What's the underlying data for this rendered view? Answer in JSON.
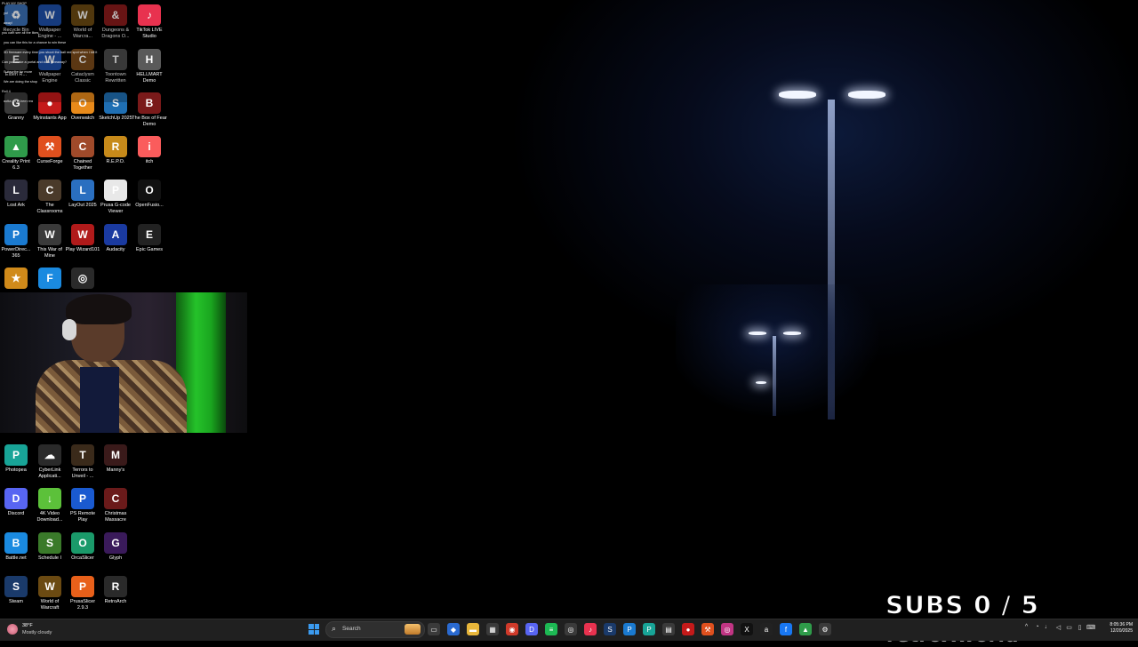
{
  "chat": [
    "PLAY MY SHOP",
    "yo!",
    "away!",
    "you cant see all the likes",
    "you can like this for a chance to win these",
    "3D firmware every time you shoot the ball red spot when I kill it",
    "Can you make a portal and do a giveaway?",
    "Subscribe for more",
    "We are doing the shop",
    "Roll 4",
    "gotta do kt-hem reg"
  ],
  "desktop_icons": [
    {
      "label": "Recycle Bin",
      "icon": "recycle-bin-icon",
      "color": "#3a6fb5",
      "glyph": "♻"
    },
    {
      "label": "Wallpaper Engine - ...",
      "icon": "wallpaper-engine-icon",
      "color": "#1e4fa8",
      "glyph": "W"
    },
    {
      "label": "World of Warcra...",
      "icon": "world-of-warcraft-icon",
      "color": "#6b4a12",
      "glyph": "W"
    },
    {
      "label": "Dungeons & Dragons O...",
      "icon": "dungeons-dragons-icon",
      "color": "#8a1b1b",
      "glyph": "&"
    },
    {
      "label": "TikTok LIVE Studio",
      "icon": "tiktok-live-icon",
      "color": "#e8324f",
      "glyph": "♪"
    },
    {
      "label": "Elden R...",
      "icon": "elden-ring-icon",
      "color": "#3b3b3b",
      "glyph": "E"
    },
    {
      "label": "Wallpaper Engine",
      "icon": "wallpaper-engine-icon",
      "color": "#1e4fa8",
      "glyph": "W"
    },
    {
      "label": "Cataclysm Classic",
      "icon": "cataclysm-icon",
      "color": "#7a4a1a",
      "glyph": "C"
    },
    {
      "label": "Toontown Rewritten",
      "icon": "toontown-icon",
      "color": "#4b4b4b",
      "glyph": "T"
    },
    {
      "label": "HELLMART Demo",
      "icon": "hellmart-icon",
      "color": "#5a5a5a",
      "glyph": "H"
    },
    {
      "label": "Granny",
      "icon": "granny-icon",
      "color": "#3a3a3a",
      "glyph": "G"
    },
    {
      "label": "Myinstants App",
      "icon": "myinstants-icon",
      "color": "#c41a1a",
      "glyph": "●"
    },
    {
      "label": "Overwatch",
      "icon": "overwatch-icon",
      "color": "#e88a1a",
      "glyph": "O"
    },
    {
      "label": "SketchUp 2025",
      "icon": "sketchup-icon",
      "color": "#1f6fb3",
      "glyph": "S"
    },
    {
      "label": "The Box of Fear Demo",
      "icon": "box-of-fear-icon",
      "color": "#7a1a1a",
      "glyph": "B"
    },
    {
      "label": "Creality Print 6.3",
      "icon": "creality-print-icon",
      "color": "#2f9b4a",
      "glyph": "▲"
    },
    {
      "label": "CurseForge",
      "icon": "curseforge-icon",
      "color": "#e0501e",
      "glyph": "⚒"
    },
    {
      "label": "Chained Together",
      "icon": "chained-together-icon",
      "color": "#a04a2a",
      "glyph": "C"
    },
    {
      "label": "R.E.P.O.",
      "icon": "repo-icon",
      "color": "#c78a1a",
      "glyph": "R"
    },
    {
      "label": "itch",
      "icon": "itch-icon",
      "color": "#fa5c5c",
      "glyph": "i"
    },
    {
      "label": "Lost Ark",
      "icon": "lost-ark-icon",
      "color": "#2a2a3a",
      "glyph": "L"
    },
    {
      "label": "The Classrooms",
      "icon": "classrooms-icon",
      "color": "#4a3a2a",
      "glyph": "C"
    },
    {
      "label": "LayOut 2025",
      "icon": "layout-icon",
      "color": "#2a6fc0",
      "glyph": "L"
    },
    {
      "label": "Prusa G-code Viewer",
      "icon": "prusa-viewer-icon",
      "color": "#e8e8e8",
      "glyph": "P"
    },
    {
      "label": "OpenFusio...",
      "icon": "openfusion-icon",
      "color": "#111111",
      "glyph": "O"
    },
    {
      "label": "PowerDirec... 365",
      "icon": "powerdirector-icon",
      "color": "#1a7ad0",
      "glyph": "P"
    },
    {
      "label": "This War of Mine",
      "icon": "this-war-of-mine-icon",
      "color": "#3a3a3a",
      "glyph": "W"
    },
    {
      "label": "Play Wizard101",
      "icon": "wizard101-icon",
      "color": "#b01a1a",
      "glyph": "W"
    },
    {
      "label": "Audacity",
      "icon": "audacity-icon",
      "color": "#1a3aa0",
      "glyph": "A"
    },
    {
      "label": "Epic Games",
      "icon": "epic-games-icon",
      "color": "#222222",
      "glyph": "E"
    },
    {
      "label": "",
      "icon": "game-icon",
      "color": "#d08a1a",
      "glyph": "★"
    },
    {
      "label": "",
      "icon": "facebook-gaming-icon",
      "color": "#1a8ae0",
      "glyph": "F"
    },
    {
      "label": "",
      "icon": "camera-app-icon",
      "color": "#2a2a2a",
      "glyph": "◎"
    },
    {
      "label": "Photopea",
      "icon": "photopea-icon",
      "color": "#18a497",
      "glyph": "P"
    },
    {
      "label": "CyberLink Applicati...",
      "icon": "cyberlink-icon",
      "color": "#2a2a2a",
      "glyph": "☁"
    },
    {
      "label": "Terrors to Unveil - ...",
      "icon": "terrors-to-unveil-icon",
      "color": "#3a2a1a",
      "glyph": "T"
    },
    {
      "label": "Manny's",
      "icon": "mannys-icon",
      "color": "#3a1a1a",
      "glyph": "M"
    },
    {
      "label": "Discord",
      "icon": "discord-icon",
      "color": "#5865f2",
      "glyph": "D"
    },
    {
      "label": "4K Video Download...",
      "icon": "4k-video-downloader-icon",
      "color": "#5cc13a",
      "glyph": "↓"
    },
    {
      "label": "PS Remote Play",
      "icon": "ps-remote-play-icon",
      "color": "#1a5ad0",
      "glyph": "P"
    },
    {
      "label": "Christmas Massacre",
      "icon": "christmas-massacre-icon",
      "color": "#6a1a1a",
      "glyph": "C"
    },
    {
      "label": "Battle.net",
      "icon": "battle-net-icon",
      "color": "#1a8ae0",
      "glyph": "B"
    },
    {
      "label": "Schedule I",
      "icon": "schedule-i-icon",
      "color": "#3a7a2a",
      "glyph": "S"
    },
    {
      "label": "OrcaSlicer",
      "icon": "orcaslicer-icon",
      "color": "#1a9a6a",
      "glyph": "O"
    },
    {
      "label": "Glyph",
      "icon": "glyph-icon",
      "color": "#3a1a5a",
      "glyph": "G"
    },
    {
      "label": "Steam",
      "icon": "steam-icon",
      "color": "#1a3a6a",
      "glyph": "S"
    },
    {
      "label": "World of Warcraft",
      "icon": "world-of-warcraft-icon",
      "color": "#6b4a12",
      "glyph": "W"
    },
    {
      "label": "PrusaSlicer 2.9.3",
      "icon": "prusaslicer-icon",
      "color": "#e8601a",
      "glyph": "P"
    },
    {
      "label": "RetroArch",
      "icon": "retroarch-icon",
      "color": "#2a2a2a",
      "glyph": "R"
    }
  ],
  "overlay": {
    "subs_counter": "SUBS 0 / 5",
    "brand": "retroXworld"
  },
  "taskbar": {
    "weather_temp": "38°F",
    "weather_condition": "Mostly cloudy",
    "search_label": "Search",
    "apps": [
      {
        "name": "task-view-icon",
        "color": "#3a3a3a",
        "glyph": "▭"
      },
      {
        "name": "copilot-icon",
        "color": "#2a6ad0",
        "glyph": "◆"
      },
      {
        "name": "file-explorer-icon",
        "color": "#e8b63a",
        "glyph": "▬"
      },
      {
        "name": "microsoft-store-icon",
        "color": "#3a3a3a",
        "glyph": "▦"
      },
      {
        "name": "chrome-icon",
        "color": "#d03a2a",
        "glyph": "◉"
      },
      {
        "name": "discord-icon",
        "color": "#5865f2",
        "glyph": "D"
      },
      {
        "name": "spotify-icon",
        "color": "#1db954",
        "glyph": "≡"
      },
      {
        "name": "obs-icon",
        "color": "#3a3a3a",
        "glyph": "◎"
      },
      {
        "name": "tiktok-icon",
        "color": "#e8324f",
        "glyph": "♪"
      },
      {
        "name": "steam-icon",
        "color": "#1a3a6a",
        "glyph": "S"
      },
      {
        "name": "powerdirector-icon",
        "color": "#1a7ad0",
        "glyph": "P"
      },
      {
        "name": "photopea-icon",
        "color": "#18a497",
        "glyph": "P"
      },
      {
        "name": "notepad-icon",
        "color": "#3a3a3a",
        "glyph": "▤"
      },
      {
        "name": "myinstants-icon",
        "color": "#c41a1a",
        "glyph": "●"
      },
      {
        "name": "curseforge-icon",
        "color": "#e0501e",
        "glyph": "⚒"
      },
      {
        "name": "instagram-icon",
        "color": "#c13584",
        "glyph": "◎"
      },
      {
        "name": "x-icon",
        "color": "#111111",
        "glyph": "X"
      },
      {
        "name": "amazon-icon",
        "color": "#222222",
        "glyph": "a"
      },
      {
        "name": "facebook-icon",
        "color": "#1877f2",
        "glyph": "f"
      },
      {
        "name": "creality-print-icon",
        "color": "#2f9b4a",
        "glyph": "▲"
      },
      {
        "name": "settings-icon",
        "color": "#3a3a3a",
        "glyph": "⚙"
      }
    ],
    "tray": [
      {
        "name": "chevron-up-icon",
        "glyph": "^"
      },
      {
        "name": "network-icon",
        "glyph": "◔"
      },
      {
        "name": "microphone-icon",
        "glyph": "♩"
      },
      {
        "name": "volume-icon",
        "glyph": "◁"
      },
      {
        "name": "display-icon",
        "glyph": "▭"
      },
      {
        "name": "battery-icon",
        "glyph": "▯"
      },
      {
        "name": "language-icon",
        "glyph": "⌨"
      }
    ],
    "time": "8:05:36 PM",
    "date": "12/20/2025"
  }
}
